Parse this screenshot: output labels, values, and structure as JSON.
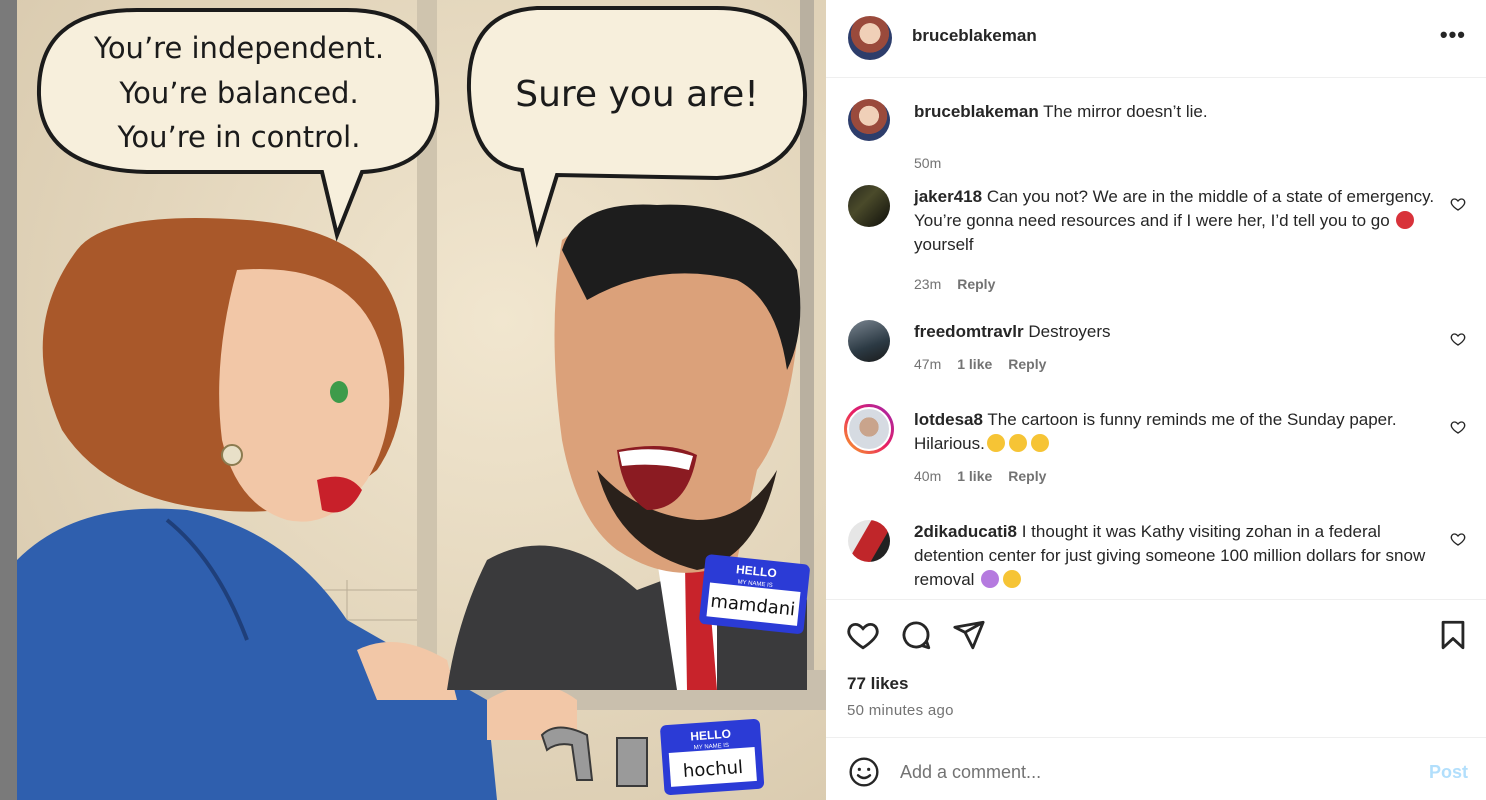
{
  "media": {
    "bubble_left_lines": [
      "You’re independent.",
      "You’re balanced.",
      "You’re in control."
    ],
    "bubble_right": "Sure you are!",
    "tag_hello": "HELLO",
    "tag_sub": "MY NAME IS",
    "tag_man_name": "mamdani",
    "tag_woman_name": "hochul"
  },
  "header": {
    "username": "bruceblakeman",
    "more_icon": "more-horizontal-icon"
  },
  "caption": {
    "username": "bruceblakeman",
    "text": "The mirror doesn’t lie.",
    "time": "50m"
  },
  "comments": [
    {
      "username": "jaker418",
      "text_a": "Can you not? We are in the middle of a state of emergency. You’re gonna need resources and if I were her, I’d tell you to go",
      "text_b": "yourself",
      "emoji": "angry-face-emoji",
      "time": "23m",
      "likes": "",
      "reply": "Reply"
    },
    {
      "username": "freedomtravlr",
      "text_a": "Destroyers",
      "time": "47m",
      "likes": "1 like",
      "reply": "Reply"
    },
    {
      "username": "lotdesa8",
      "text_a": "The cartoon is funny reminds me of the Sunday paper. Hilarious.",
      "emoji": "laughing-face-emoji",
      "time": "40m",
      "likes": "1 like",
      "reply": "Reply"
    },
    {
      "username": "2dikaducati8",
      "text_a": "I thought it was Kathy visiting zohan in a federal detention center for just giving someone 100 million dollars for snow removal",
      "emoji": "shrug-and-eyeroll-emoji",
      "time": "",
      "likes": "",
      "reply": ""
    }
  ],
  "actions": {
    "likes": "77 likes",
    "posted_ago": "50 minutes ago",
    "icons": [
      "heart-icon",
      "comment-icon",
      "share-icon",
      "bookmark-icon"
    ]
  },
  "add_comment": {
    "placeholder": "Add a comment...",
    "post_label": "Post"
  },
  "colors": {
    "post_button": "#b2dffc",
    "secondary_text": "#737373",
    "primary_text": "#262626"
  }
}
